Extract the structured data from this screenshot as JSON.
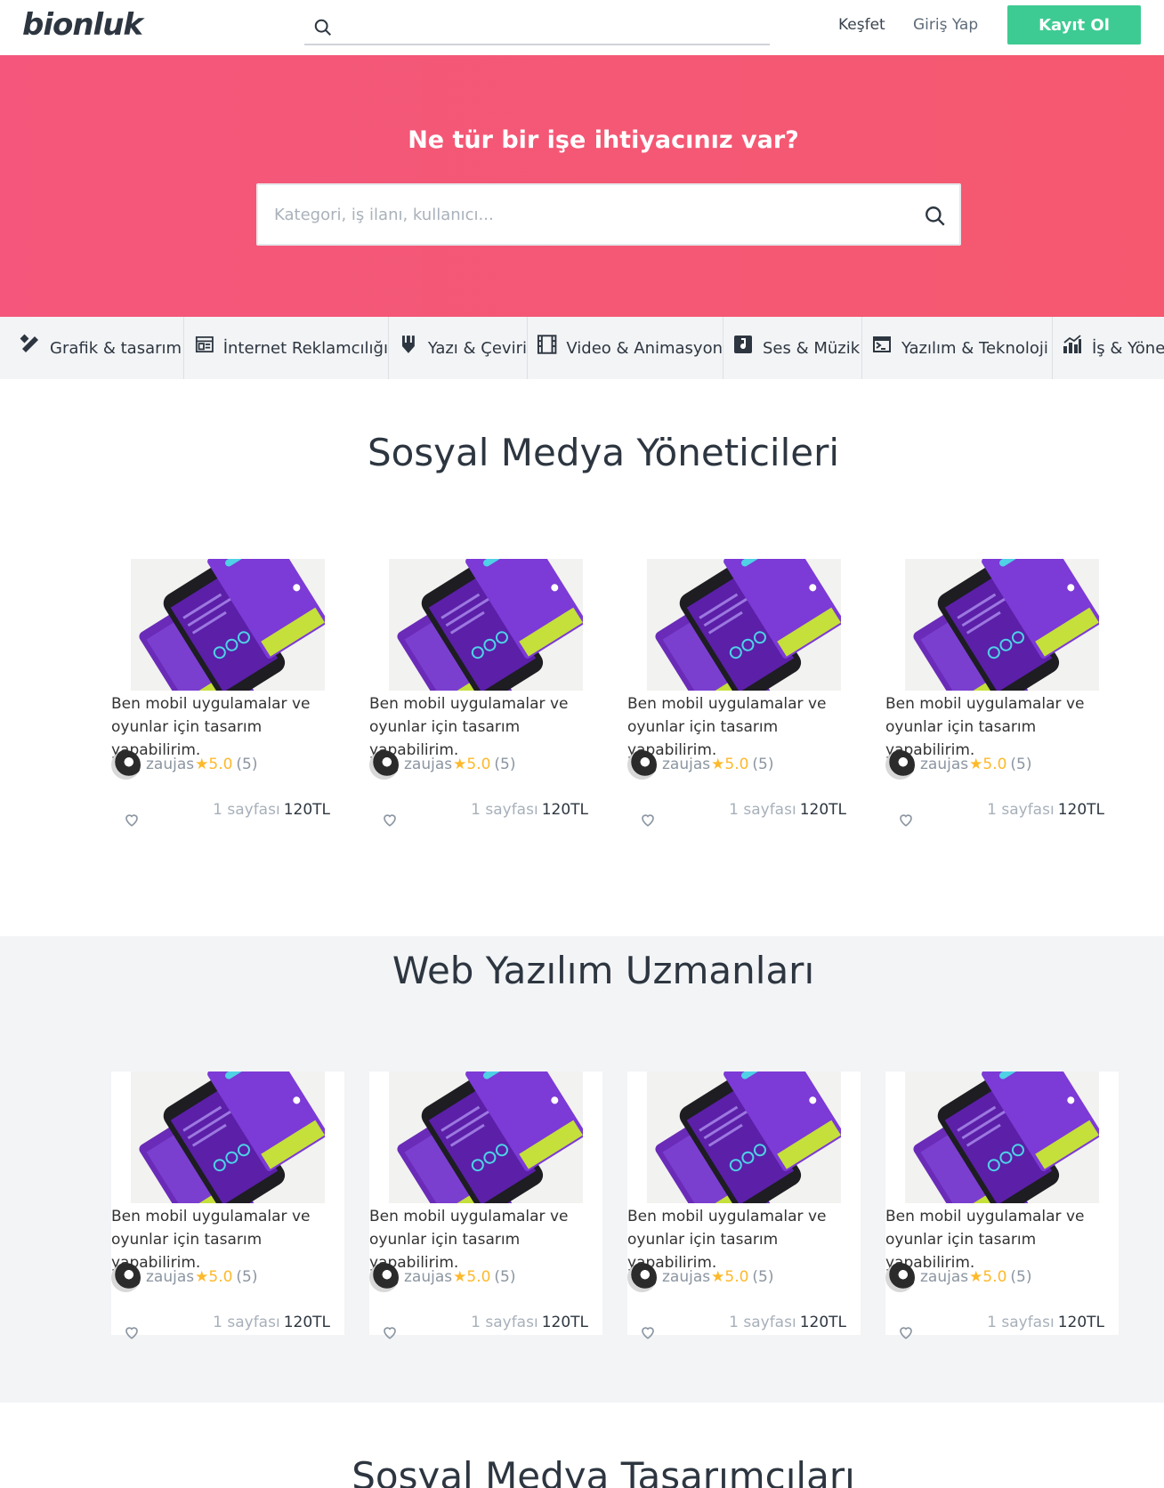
{
  "header": {
    "logo": "bionluk",
    "discover_label": "Keşfet",
    "login_label": "Giriş Yap",
    "signup_label": "Kayıt Ol"
  },
  "hero": {
    "title": "Ne tür bir işe ihtiyacınız var?",
    "search_placeholder": "Kategori, iş ilanı, kullanıcı..."
  },
  "categories": [
    {
      "label": "Grafik & tasarım",
      "icon": "design-tools-icon"
    },
    {
      "label": "İnternet Reklamcılığı",
      "icon": "browser-ad-icon"
    },
    {
      "label": "Yazı & Çeviri",
      "icon": "pen-nib-icon"
    },
    {
      "label": "Video & Animasyon",
      "icon": "film-icon"
    },
    {
      "label": "Ses & Müzik",
      "icon": "music-note-icon"
    },
    {
      "label": "Yazılım & Teknoloji",
      "icon": "terminal-icon"
    },
    {
      "label": "İş & Yönet",
      "icon": "bar-chart-icon"
    }
  ],
  "sections": [
    {
      "title": "Sosyal Medya Yöneticileri",
      "cards": [
        {
          "title": "Ben mobil uygulamalar ve oyunlar için tasarım yapabilirim.",
          "seller": "zaujas",
          "rating": "5.0",
          "reviews": "(5)",
          "unit": "1 sayfası",
          "price": "120TL"
        },
        {
          "title": "Ben mobil uygulamalar ve oyunlar için tasarım yapabilirim.",
          "seller": "zaujas",
          "rating": "5.0",
          "reviews": "(5)",
          "unit": "1 sayfası",
          "price": "120TL"
        },
        {
          "title": "Ben mobil uygulamalar ve oyunlar için tasarım yapabilirim.",
          "seller": "zaujas",
          "rating": "5.0",
          "reviews": "(5)",
          "unit": "1 sayfası",
          "price": "120TL"
        },
        {
          "title": "Ben mobil uygulamalar ve oyunlar için tasarım yapabilirim.",
          "seller": "zaujas",
          "rating": "5.0",
          "reviews": "(5)",
          "unit": "1 sayfası",
          "price": "120TL"
        }
      ]
    },
    {
      "title": "Web Yazılım Uzmanları",
      "cards": [
        {
          "title": "Ben mobil uygulamalar ve oyunlar için tasarım yapabilirim.",
          "seller": "zaujas",
          "rating": "5.0",
          "reviews": "(5)",
          "unit": "1 sayfası",
          "price": "120TL"
        },
        {
          "title": "Ben mobil uygulamalar ve oyunlar için tasarım yapabilirim.",
          "seller": "zaujas",
          "rating": "5.0",
          "reviews": "(5)",
          "unit": "1 sayfası",
          "price": "120TL"
        },
        {
          "title": "Ben mobil uygulamalar ve oyunlar için tasarım yapabilirim.",
          "seller": "zaujas",
          "rating": "5.0",
          "reviews": "(5)",
          "unit": "1 sayfası",
          "price": "120TL"
        },
        {
          "title": "Ben mobil uygulamalar ve oyunlar için tasarım yapabilirim.",
          "seller": "zaujas",
          "rating": "5.0",
          "reviews": "(5)",
          "unit": "1 sayfası",
          "price": "120TL"
        }
      ]
    },
    {
      "title": "Sosyal Medya Tasarımcıları",
      "cards": []
    }
  ],
  "colors": {
    "brand_green": "#3ecb93",
    "hero_pink": "#f4577b",
    "star_orange": "#fdb92b",
    "text_dark": "#2d3640"
  }
}
